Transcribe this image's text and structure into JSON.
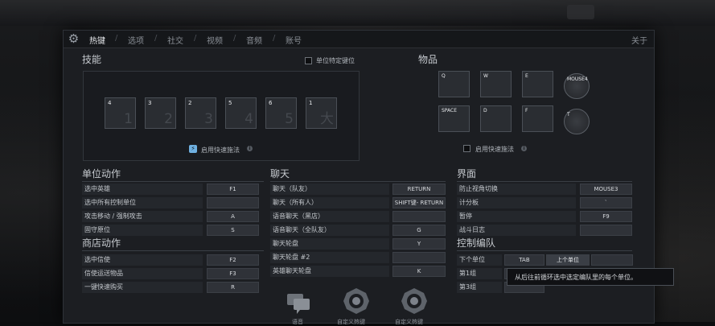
{
  "tabs": [
    {
      "label": "热键",
      "active": true
    },
    {
      "label": "选项",
      "active": false
    },
    {
      "label": "社交",
      "active": false
    },
    {
      "label": "视频",
      "active": false
    },
    {
      "label": "音频",
      "active": false
    },
    {
      "label": "账号",
      "active": false
    }
  ],
  "about_label": "关于",
  "abilities": {
    "title": "技能",
    "unit_specific_label": "单位特定键位",
    "slots": [
      {
        "key": "4",
        "num": "1"
      },
      {
        "key": "3",
        "num": "2"
      },
      {
        "key": "2",
        "num": "3"
      },
      {
        "key": "5",
        "num": "4"
      },
      {
        "key": "6",
        "num": "5"
      },
      {
        "key": "1",
        "num": "大"
      }
    ],
    "quick_cast_label": "启用快速施法"
  },
  "items": {
    "title": "物品",
    "slots": [
      "Q",
      "W",
      "E",
      "SPACE",
      "D",
      "F"
    ],
    "mouse_slot": "MOUSE4",
    "t_slot": "T",
    "quick_cast_label": "启用快速施法"
  },
  "unit_actions": {
    "title": "单位动作",
    "rows": [
      {
        "label": "选中英雄",
        "key": "F1"
      },
      {
        "label": "选中所有控制单位",
        "key": ""
      },
      {
        "label": "攻击移动 / 强制攻击",
        "key": "A"
      },
      {
        "label": "固守原位",
        "key": "S"
      }
    ]
  },
  "shop_actions": {
    "title": "商店动作",
    "rows": [
      {
        "label": "选中信使",
        "key": "F2"
      },
      {
        "label": "信使运送物品",
        "key": "F3"
      },
      {
        "label": "一键快速购买",
        "key": "R"
      }
    ]
  },
  "chat": {
    "title": "聊天",
    "rows": [
      {
        "label": "聊天（队友）",
        "key": "RETURN"
      },
      {
        "label": "聊天（所有人）",
        "key": "SHIFT键- RETURN"
      },
      {
        "label": "语音聊天（黑店）",
        "key": ""
      },
      {
        "label": "语音聊天（全队友）",
        "key": "G"
      },
      {
        "label": "聊天轮盘",
        "key": "Y"
      },
      {
        "label": "聊天轮盘 #2",
        "key": ""
      },
      {
        "label": "英雄聊天轮盘",
        "key": "K"
      }
    ]
  },
  "interface": {
    "title": "界面",
    "rows": [
      {
        "label": "防止视角切换",
        "key": "MOUSE3"
      },
      {
        "label": "计分板",
        "key": "`"
      },
      {
        "label": "暂停",
        "key": "F9"
      },
      {
        "label": "战斗日志",
        "key": ""
      }
    ]
  },
  "control_groups": {
    "title": "控制编队",
    "rows": [
      {
        "label": "下个单位",
        "key": "TAB",
        "key2": "上个单位"
      },
      {
        "label": "第1组",
        "key": "",
        "key2": ""
      },
      {
        "label": "第3组",
        "key": "",
        "key2": ""
      }
    ],
    "tooltip": "从后往前循环选中选定编队里的每个单位。"
  },
  "bottom_labels": [
    "语音",
    "自定义热键",
    "自定义热键"
  ],
  "colors": {
    "accent": "#6fb0e0",
    "panel": "#1c1e22",
    "row": "#24272c"
  }
}
